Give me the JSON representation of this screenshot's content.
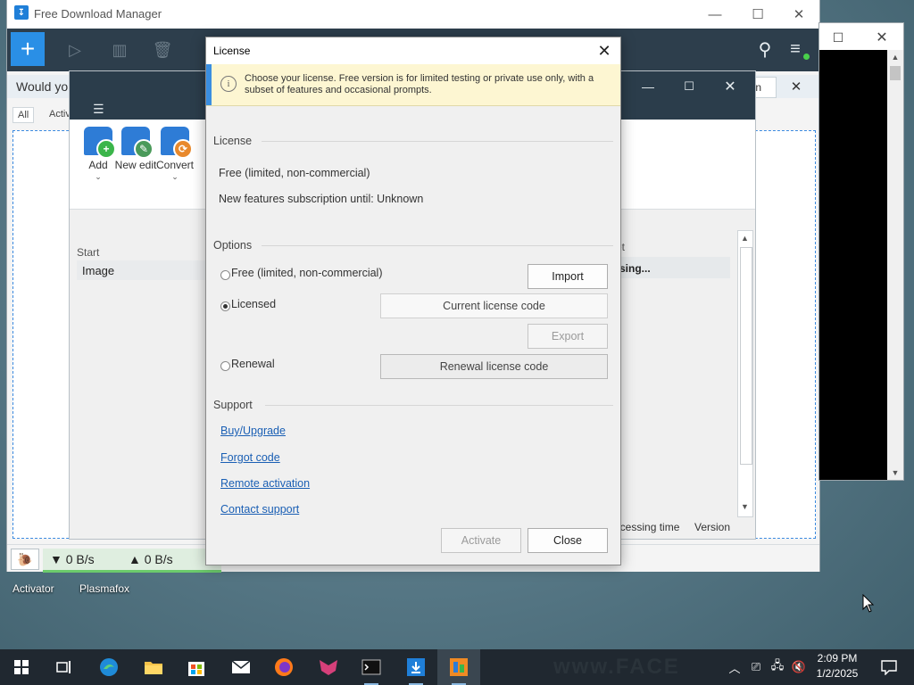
{
  "fdm": {
    "title": "Free Download Manager",
    "banner_text": "Would you",
    "banner_button": "ain",
    "tabs": [
      "All",
      "Activ"
    ],
    "status": {
      "down": "▼ 0 B/s",
      "up": "▲ 0 B/s"
    }
  },
  "converter": {
    "ribbon": {
      "add": "Add",
      "new_edit": "New edit",
      "convert": "Convert"
    },
    "col_start": "Start",
    "row_text": "Image",
    "col_right": "et",
    "row_right": "sing...",
    "footer": {
      "processing": "ocessing time",
      "version": "Version"
    }
  },
  "dialog": {
    "title": "License",
    "info": "Choose your license. Free version is for limited testing or private use only, with a subset of features and occasional prompts.",
    "license_section": "License",
    "license_value": "Free (limited, non-commercial)",
    "subscription": "New features subscription until: Unknown",
    "options_section": "Options",
    "options": {
      "free": "Free (limited, non-commercial)",
      "licensed": "Licensed",
      "renewal": "Renewal"
    },
    "selected_option": "licensed",
    "buttons": {
      "import": "Import",
      "current_code": "Current license code",
      "export": "Export",
      "renewal_code": "Renewal license code",
      "activate": "Activate",
      "close": "Close"
    },
    "support_section": "Support",
    "links": {
      "buy": "Buy/Upgrade",
      "forgot": "Forgot code",
      "remote": "Remote activation",
      "contact": "Contact support"
    }
  },
  "desktop": {
    "icons": [
      "Activator",
      "Plasmafox"
    ]
  },
  "taskbar": {
    "time": "2:09 PM",
    "date": "1/2/2025",
    "watermark": "www.FACE"
  },
  "colors": {
    "accent": "#2a8fe6",
    "toolbar": "#2d3e4c",
    "info_bg": "#fdf6d2",
    "link": "#1a5fb4"
  }
}
